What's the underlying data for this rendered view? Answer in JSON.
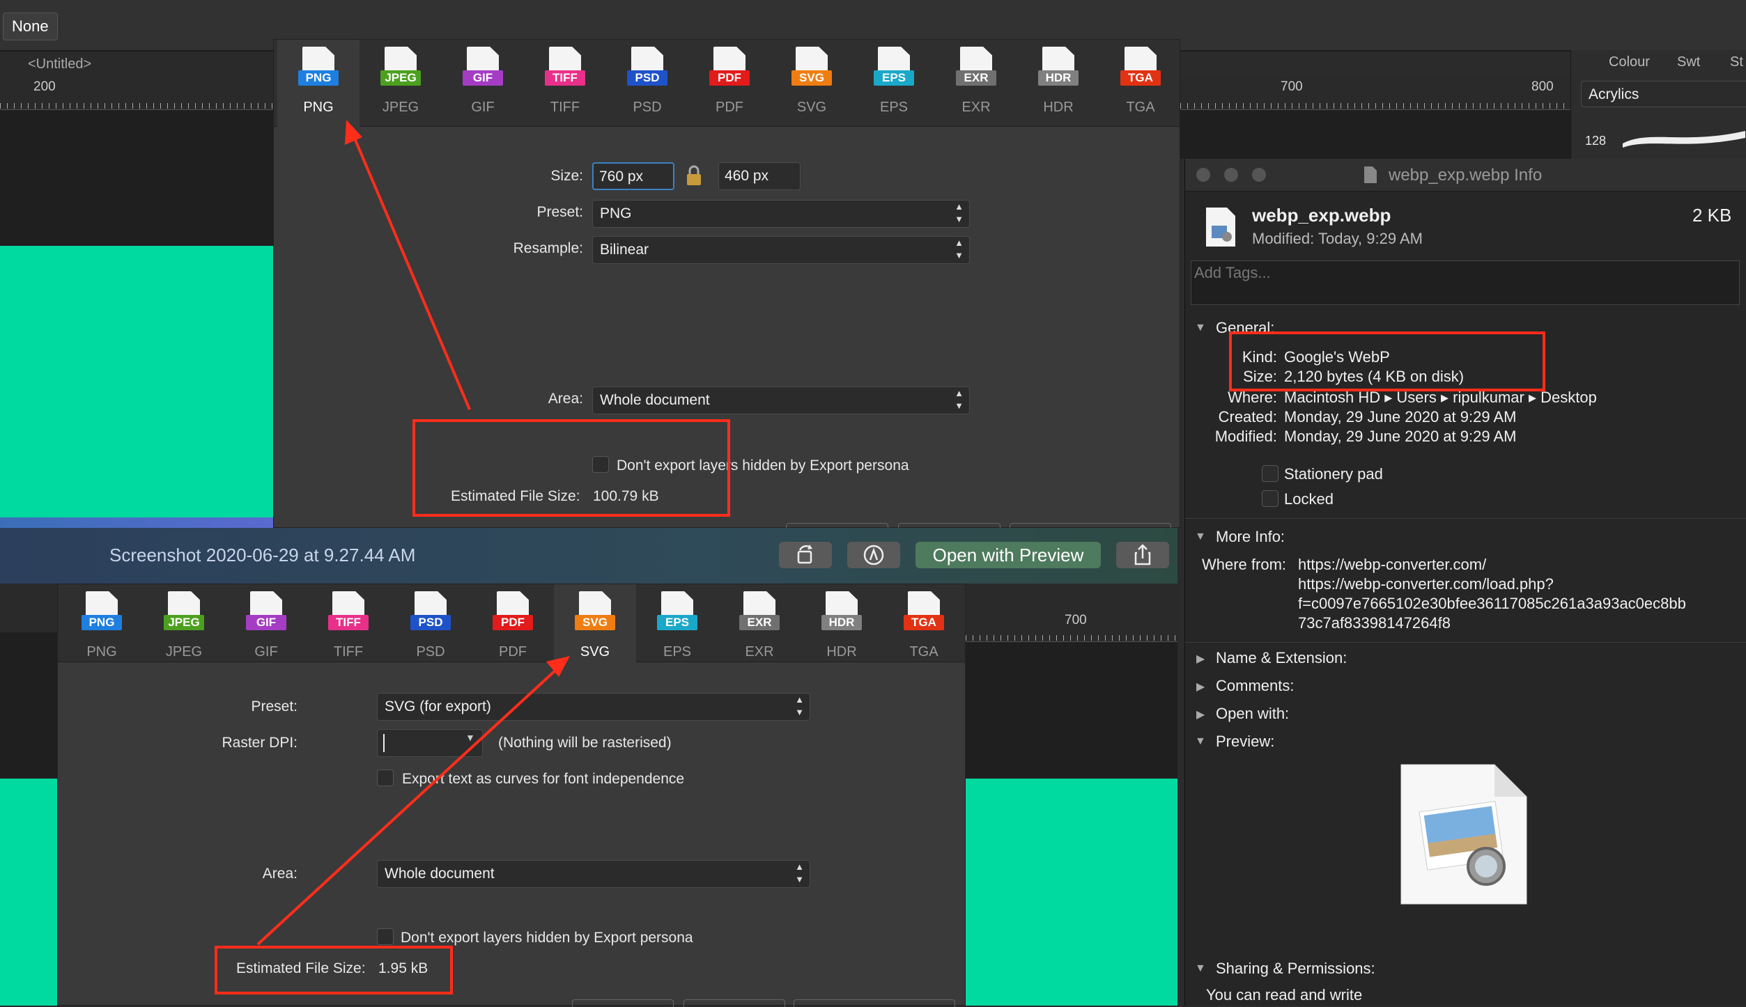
{
  "app": {
    "none_label": "None",
    "doc_tab": "<Untitled>",
    "ruler_left": "200",
    "ruler_right_a": "700",
    "ruler_right_b": "800",
    "ruler_bottom": "700",
    "right_tabs": [
      "Colour",
      "Swt",
      "St"
    ],
    "acrylics": "Acrylics",
    "brush_size": "128"
  },
  "formats": [
    {
      "label": "PNG",
      "color": "#1e7fe0"
    },
    {
      "label": "JPEG",
      "color": "#4ca01f"
    },
    {
      "label": "GIF",
      "color": "#a53cc4"
    },
    {
      "label": "TIFF",
      "color": "#e8308a"
    },
    {
      "label": "PSD",
      "color": "#1e52c8"
    },
    {
      "label": "PDF",
      "color": "#e21b1b"
    },
    {
      "label": "SVG",
      "color": "#ef7d12"
    },
    {
      "label": "EPS",
      "color": "#1aa8c9"
    },
    {
      "label": "EXR",
      "color": "#707070"
    },
    {
      "label": "HDR",
      "color": "#808080"
    },
    {
      "label": "TGA",
      "color": "#e23214"
    }
  ],
  "export_top": {
    "size_label": "Size:",
    "width": "760 px",
    "height": "460 px",
    "preset_label": "Preset:",
    "preset": "PNG",
    "resample_label": "Resample:",
    "resample": "Bilinear",
    "area_label": "Area:",
    "area": "Whole document",
    "hidden_layers": "Don't export layers hidden by Export persona",
    "est_label": "Estimated File Size:",
    "est_value": "100.79 kB"
  },
  "preview_window": {
    "title": "Screenshot 2020-06-29 at 9.27.44 AM",
    "open_with": "Open with Preview"
  },
  "export_bottom": {
    "preset_label": "Preset:",
    "preset": "SVG (for export)",
    "dpi_label": "Raster DPI:",
    "dpi_note": "(Nothing will be rasterised)",
    "curves": "Export text as curves for font independence",
    "area_label": "Area:",
    "area": "Whole document",
    "hidden_layers": "Don't export layers hidden by Export persona",
    "est_label": "Estimated File Size:",
    "est_value": "1.95 kB"
  },
  "info": {
    "window_title": "webp_exp.webp Info",
    "file_name": "webp_exp.webp",
    "file_size": "2 KB",
    "modified_line": "Modified: Today, 9:29 AM",
    "tags_placeholder": "Add Tags...",
    "general": "General:",
    "kind_label": "Kind:",
    "kind": "Google's WebP",
    "size_label": "Size:",
    "size": "2,120 bytes (4 KB on disk)",
    "where_label": "Where:",
    "where": "Macintosh HD ▸ Users ▸ ripulkumar ▸ Desktop",
    "created_label": "Created:",
    "created": "Monday, 29 June 2020 at 9:29 AM",
    "modified_label": "Modified:",
    "modified": "Monday, 29 June 2020 at 9:29 AM",
    "stationery": "Stationery pad",
    "locked": "Locked",
    "more_info": "More Info:",
    "where_from_label": "Where from:",
    "where_from_1": "https://webp-converter.com/",
    "where_from_2": "https://webp-converter.com/load.php?",
    "where_from_3": "f=c0097e7665102e30bfee36117085c261a3a93ac0ec8bb",
    "where_from_4": "73c7af83398147264f8",
    "name_ext": "Name & Extension:",
    "comments": "Comments:",
    "open_with": "Open with:",
    "preview": "Preview:",
    "sharing": "Sharing & Permissions:",
    "sharing_text": "You can read and write"
  }
}
